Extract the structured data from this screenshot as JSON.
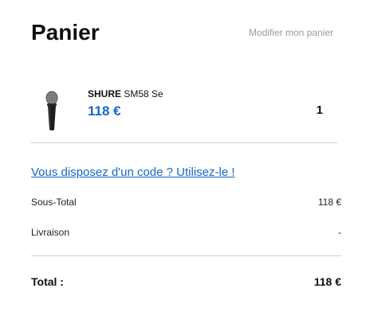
{
  "header": {
    "title": "Panier",
    "edit_link": "Modifier mon panier"
  },
  "cart": {
    "items": [
      {
        "brand": "SHURE",
        "model": "SM58 Se",
        "price": "118 €",
        "quantity": "1",
        "image_icon": "microphone-icon"
      }
    ]
  },
  "promo": {
    "link_text": "Vous disposez d'un code ? Utilisez-le !"
  },
  "summary": {
    "subtotal_label": "Sous-Total",
    "subtotal_value": "118 €",
    "shipping_label": "Livraison",
    "shipping_value": "-",
    "total_label": "Total :",
    "total_value": "118 €"
  },
  "colors": {
    "accent": "#1668c6",
    "muted": "#9a9a9a",
    "divider": "#d2d2d2"
  }
}
